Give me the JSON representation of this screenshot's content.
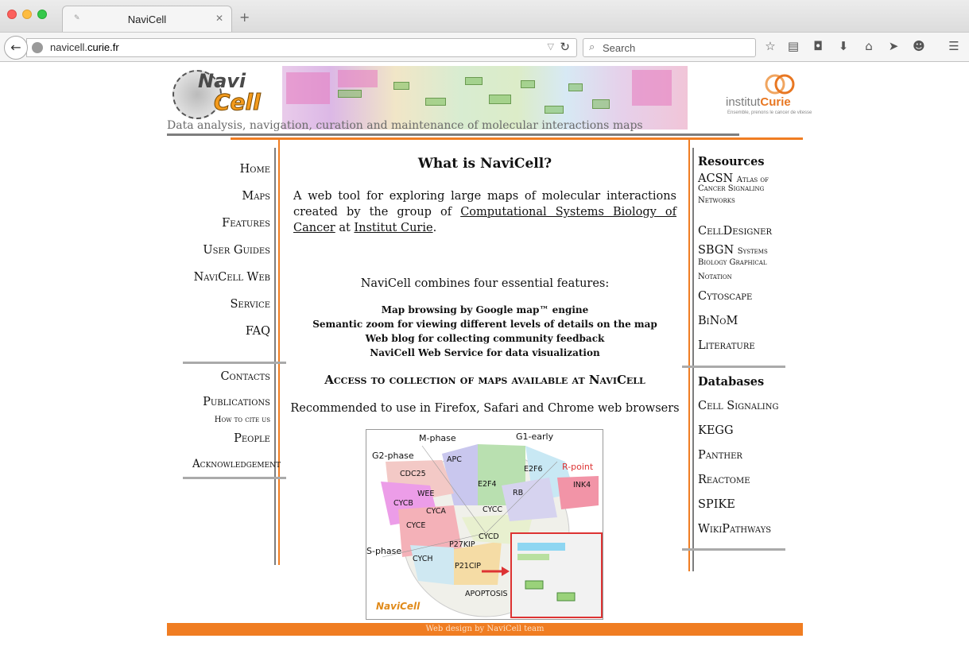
{
  "browser": {
    "tab_title": "NaviCell",
    "url_host_prefix": "navicell.",
    "url_host_main": "curie.fr",
    "search_placeholder": "Search"
  },
  "header": {
    "logo_navi": "Navi",
    "logo_cell": "Cell",
    "tagline": "Data analysis, navigation, curation and maintenance of molecular interactions maps",
    "institute_name_prefix": "institut",
    "institute_name_brand": "Curie",
    "institute_tagline": "Ensemble, prenons le cancer de vitesse"
  },
  "left_menu": {
    "home": "Home",
    "maps": "Maps",
    "features": "Features",
    "user_guides": "User Guides",
    "navicell_web": "NaviCell Web",
    "service": "Service",
    "faq": "FAQ",
    "contacts": "Contacts",
    "publications": "Publications",
    "how_to_cite": "How to cite us",
    "people": "People",
    "acknowledgement": "Acknowledgement"
  },
  "main": {
    "title": "What is NaviCell?",
    "intro_before": "A web tool for exploring large maps of molecular interactions created by the group of ",
    "intro_link1": "Computational Systems Biology of Cancer",
    "intro_middle": " at ",
    "intro_link2": "Institut Curie",
    "intro_after": ".",
    "combines": "NaviCell combines four essential features:",
    "features": [
      "Map browsing by Google map™ engine",
      "Semantic zoom for viewing different levels of details on the map",
      "Web blog for collecting community feedback",
      "NaviCell Web Service for data visualization"
    ],
    "access_link": "Access to collection of maps available at NaviCell",
    "recommend": "Recommended to use in Firefox, Safari and Chrome web browsers",
    "map_labels": {
      "m_phase": "M-phase",
      "g1_early": "G1-early",
      "g2_phase": "G2-phase",
      "r_point": "R-point",
      "apc": "APC",
      "cdc25": "CDC25",
      "e2f4": "E2F4",
      "e2f6": "E2F6",
      "ink4": "INK4",
      "wee": "WEE",
      "rb": "RB",
      "cycb": "CYCB",
      "cyca": "CYCA",
      "cycc": "CYCC",
      "cyce": "CYCE",
      "cycd": "CYCD",
      "p27kip": "P27KIP",
      "s_phase": "S-phase",
      "cych": "CYCH",
      "p21cip": "P21CIP",
      "apoptosis": "APOPTOSIS"
    }
  },
  "right": {
    "resources_head": "Resources",
    "acsn": "ACSN",
    "acsn_desc1": "Atlas of",
    "acsn_desc2": "Cancer Signaling",
    "acsn_desc3": "Networks",
    "celldesigner": "CellDesigner",
    "sbgn": "SBGN",
    "sbgn_desc1": "Systems",
    "sbgn_desc2": "Biology Graphical",
    "sbgn_desc3": "Notation",
    "cytoscape": "Cytoscape",
    "binom": "BiNoM",
    "literature": "Literature",
    "databases_head": "Databases",
    "cell_signaling": "Cell Signaling",
    "kegg": "KEGG",
    "panther": "Panther",
    "reactome": "Reactome",
    "spike": "SPIKE",
    "wikipathways": "WikiPathways"
  },
  "footer": {
    "text": "Web design by NaviCell team"
  },
  "colors": {
    "accent_orange": "#f07d22",
    "rule_grey": "#7d7d7d"
  }
}
